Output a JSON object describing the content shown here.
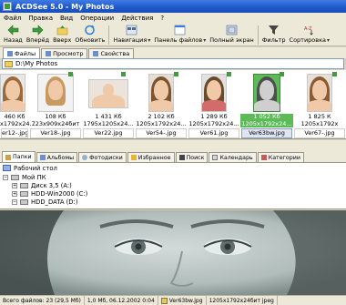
{
  "window": {
    "title": "ACDSee 5.0 - My Photos"
  },
  "menu": [
    "Файл",
    "Правка",
    "Вид",
    "Операции",
    "Действия",
    "?"
  ],
  "toolbar": {
    "back": "Назад",
    "forward": "Вперёд",
    "up": "Вверх",
    "refresh": "Обновить",
    "navigation": "Навигация",
    "files_panel": "Панель файлов",
    "fullscreen": "Полный экран",
    "filter": "Фильтр",
    "sort": "Сортировка"
  },
  "tabs": [
    "Файлы",
    "Просмотр",
    "Свойства"
  ],
  "path": "D:\\My Photos",
  "thumbnails": [
    {
      "size": "460 Кб",
      "dims": "x1792x24...",
      "name": "er12-.jpg"
    },
    {
      "size": "108 Кб",
      "dims": "723x909x24бит",
      "name": "Ver18-.jpg"
    },
    {
      "size": "1 431 Кб",
      "dims": "1795x1205x24...",
      "name": "Ver22.jpg"
    },
    {
      "size": "2 102 Кб",
      "dims": "1205x1792x24...",
      "name": "Ver54-.jpg"
    },
    {
      "size": "1 289 Кб",
      "dims": "1205x1792x24...",
      "name": "Ver61.jpg"
    },
    {
      "size": "1 052 Кб",
      "dims": "1205x1792x24...",
      "name": "Ver63bw.jpg"
    },
    {
      "size": "1 825 К",
      "dims": "1205x1792x",
      "name": "Ver67-.jpg"
    }
  ],
  "folder_tabs": [
    "Папки",
    "Альбомы",
    "Фотодиски",
    "Избранное",
    "Поиск",
    "Календарь",
    "Категории"
  ],
  "tree": {
    "desktop": "Рабочий стол",
    "my_computer": "Мой ПК",
    "floppy": "Диск 3,5 (A:)",
    "hdd_c": "HDD-Win2000 (C:)",
    "hdd_d": "HDD_DATA (D:)"
  },
  "status": {
    "total": "Всего файлов: 23 (29,5 Мб)",
    "file_info": "1,0 Мб, 06.12.2002 0:04",
    "file_name": "Ver63bw.jpg",
    "file_dims": "1205x1792x24бит jpeg"
  },
  "colors": {
    "title_bar": "#1d57c9",
    "selected_thumb": "#5cba57",
    "preview_tint": "#b7c4c2"
  }
}
